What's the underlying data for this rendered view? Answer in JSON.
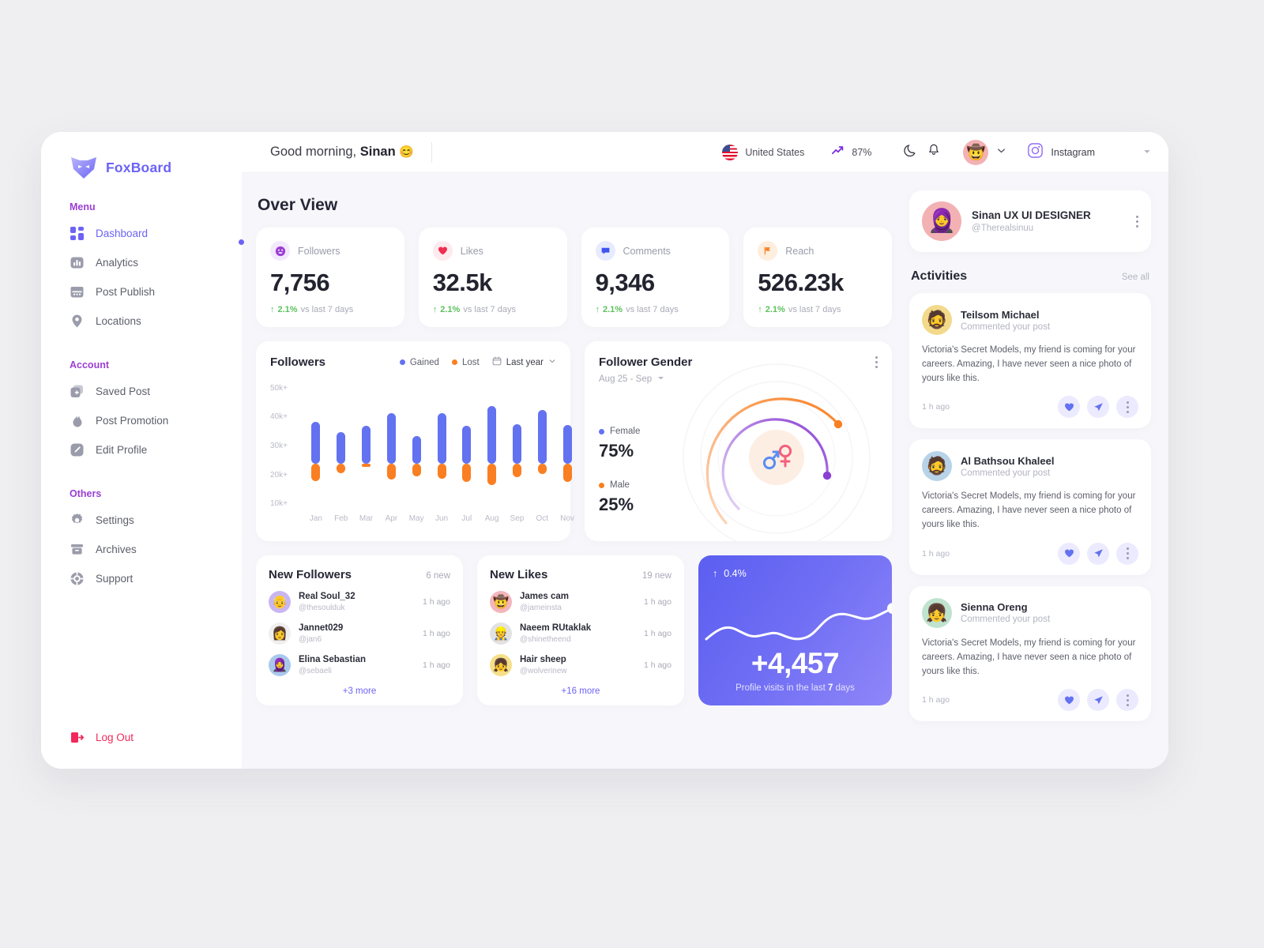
{
  "brand": {
    "name": "FoxBoard",
    "logo_icon": "fox-logo-icon",
    "color": "#6c63f5"
  },
  "sidebar": {
    "sections": [
      {
        "title": "Menu",
        "items": [
          {
            "label": "Dashboard",
            "icon": "grid-icon",
            "active": true
          },
          {
            "label": "Analytics",
            "icon": "bar-chart-icon",
            "active": false
          },
          {
            "label": "Post Publish",
            "icon": "calendar-icon",
            "active": false
          },
          {
            "label": "Locations",
            "icon": "map-pin-icon",
            "active": false
          }
        ]
      },
      {
        "title": "Account",
        "items": [
          {
            "label": "Saved Post",
            "icon": "bookmark-add-icon",
            "active": false
          },
          {
            "label": "Post Promotion",
            "icon": "flame-icon",
            "active": false
          },
          {
            "label": "Edit Profile",
            "icon": "pencil-icon",
            "active": false
          }
        ]
      },
      {
        "title": "Others",
        "items": [
          {
            "label": "Settings",
            "icon": "gear-icon",
            "active": false
          },
          {
            "label": "Archives",
            "icon": "archive-icon",
            "active": false
          },
          {
            "label": "Support",
            "icon": "lifebuoy-icon",
            "active": false
          }
        ]
      }
    ],
    "logout": {
      "label": "Log Out",
      "icon": "logout-icon",
      "color": "#f2285a"
    }
  },
  "topbar": {
    "greeting_prefix": "Good morning, ",
    "greeting_name": "Sinan",
    "greeting_emoji": "😊",
    "country": "United States",
    "country_flag_icon": "us-flag-icon",
    "trend_value": "87%",
    "trend_icon": "trending-up-icon",
    "dark_mode_icon": "moon-icon",
    "notification_icon": "bell-icon",
    "avatar_icon": "user-avatar",
    "avatar_chevron_icon": "chevron-down-icon",
    "platform": "Instagram",
    "platform_icon": "instagram-icon",
    "platform_chevron_icon": "caret-down-icon"
  },
  "overview": {
    "title": "Over View",
    "stats": [
      {
        "label": "Followers",
        "value": "7,756",
        "delta": "2.1%",
        "delta_note": "vs last 7 days",
        "icon": "smiley-icon",
        "icon_bg": "#f3e9fd",
        "icon_color": "#9b3fd4"
      },
      {
        "label": "Likes",
        "value": "32.5k",
        "delta": "2.1%",
        "delta_note": "vs last 7 days",
        "icon": "heart-icon",
        "icon_bg": "#fdeaee",
        "icon_color": "#f02d52"
      },
      {
        "label": "Comments",
        "value": "9,346",
        "delta": "2.1%",
        "delta_note": "vs last 7 days",
        "icon": "comment-icon",
        "icon_bg": "#e8ebfe",
        "icon_color": "#3d54ef"
      },
      {
        "label": "Reach",
        "value": "526.23k",
        "delta": "2.1%",
        "delta_note": "vs last 7 days",
        "icon": "flag-icon",
        "icon_bg": "#fdeede",
        "icon_color": "#fa7f22"
      }
    ]
  },
  "followers_chart": {
    "title": "Followers",
    "legend": [
      {
        "label": "Gained",
        "color": "#6372f0"
      },
      {
        "label": "Lost",
        "color": "#fa7f22"
      }
    ],
    "range_label": "Last year",
    "range_icon": "calendar-icon",
    "range_chevron_icon": "chevron-down-icon"
  },
  "gender_chart": {
    "title": "Follower Gender",
    "date_range": "Aug 25 - Sep",
    "date_chevron_icon": "caret-down-icon",
    "menu_icon": "kebab-menu-icon",
    "center_icon": "gender-symbols-icon",
    "items": [
      {
        "label": "Female",
        "value": "75%",
        "color": "#6372f0",
        "ring_color": "#8b3fd4"
      },
      {
        "label": "Male",
        "value": "25%",
        "color": "#fa7f22",
        "ring_color": "#fa7f22"
      }
    ]
  },
  "chart_data": [
    {
      "type": "bar",
      "title": "Followers",
      "xlabel": "",
      "ylabel": "",
      "categories": [
        "Jan",
        "Feb",
        "Mar",
        "Apr",
        "May",
        "Jun",
        "Jul",
        "Aug",
        "Sep",
        "Oct",
        "Nov"
      ],
      "ytick_labels": [
        "50k+",
        "40k+",
        "30k+",
        "20k+",
        "10k+"
      ],
      "ytick_values": [
        50000,
        40000,
        30000,
        20000,
        10000
      ],
      "ylim": [
        7000,
        53000
      ],
      "grid": false,
      "legend_position": "top-right",
      "series": [
        {
          "name": "Gained",
          "color": "#6372f0",
          "values": [
            38500,
            35000,
            37000,
            41500,
            33500,
            41500,
            37000,
            44000,
            37800,
            42500,
            37500
          ]
        },
        {
          "name": "Lost",
          "color": "#fa7f22",
          "values": [
            18000,
            20800,
            23000,
            18600,
            19500,
            18700,
            17700,
            16700,
            19400,
            20300,
            17700
          ]
        }
      ],
      "series_base": 24000,
      "note": "Each column spans from the Lost value (bottom, orange) up to the Gained value (top, blue), meeting near 24k."
    },
    {
      "type": "pie",
      "title": "Follower Gender",
      "subtitle": "Aug 25 - Sep",
      "labels": [
        "Female",
        "Male"
      ],
      "values": [
        75,
        25
      ],
      "colors": [
        "#8b3fd4",
        "#fa7f22"
      ],
      "legend_position": "left"
    },
    {
      "type": "line",
      "title": "Profile visits in the last 7 days",
      "value_label": "+4,457",
      "delta": "0.4%",
      "x": [
        0,
        1,
        2,
        3,
        4,
        5,
        6,
        7,
        8,
        9,
        10
      ],
      "y": [
        18,
        26,
        20,
        25,
        19,
        18,
        30,
        36,
        33,
        36,
        40
      ],
      "color": "#ffffff",
      "grid": false
    }
  ],
  "new_followers": {
    "title": "New Followers",
    "count": "6 new",
    "items": [
      {
        "name": "Real Soul_32",
        "handle": "@thesoulduk",
        "time": "1 h ago",
        "avatar_bg": "#c9b6f0",
        "emoji": "👴"
      },
      {
        "name": "Jannet029",
        "handle": "@jan6",
        "time": "1 h ago",
        "avatar_bg": "#efefef",
        "emoji": "👩"
      },
      {
        "name": "Elina Sebastian",
        "handle": "@sebaeli",
        "time": "1 h ago",
        "avatar_bg": "#a9c9ec",
        "emoji": "🧕"
      }
    ],
    "more_label": "+3 more"
  },
  "new_likes": {
    "title": "New Likes",
    "count": "19 new",
    "items": [
      {
        "name": "James cam",
        "handle": "@jameinsta",
        "time": "1 h ago",
        "avatar_bg": "#f3b6bc",
        "emoji": "🤠"
      },
      {
        "name": "Naeem RUtaklak",
        "handle": "@shinetheend",
        "time": "1 h ago",
        "avatar_bg": "#e2e2e2",
        "emoji": "👷"
      },
      {
        "name": "Hair sheep",
        "handle": "@wolverinew",
        "time": "1 h ago",
        "avatar_bg": "#f5e08a",
        "emoji": "👧"
      }
    ],
    "more_label": "+16 more"
  },
  "profile_visits": {
    "delta": "0.4%",
    "delta_icon": "arrow-up-icon",
    "value": "+4,457",
    "caption_before": "Profile visits in the last ",
    "caption_bold": "7",
    "caption_after": " days"
  },
  "profile": {
    "name": "Sinan UX UI DESIGNER",
    "handle": "@Therealsinuu",
    "avatar_bg": "#f3b1b4",
    "avatar_emoji": "🧕",
    "menu_icon": "kebab-menu-icon"
  },
  "activities": {
    "title": "Activities",
    "see_all": "See all",
    "items": [
      {
        "name": "Teilsom Michael",
        "action": "Commented your post",
        "body": "Victoria's Secret Models, my friend is coming for your careers. Amazing, I have never seen a nice photo of yours like this.",
        "time": "1 h ago",
        "avatar_bg": "#f3d98a",
        "avatar_emoji": "🧔",
        "actions": [
          {
            "icon": "heart-icon"
          },
          {
            "icon": "send-icon"
          },
          {
            "icon": "kebab-menu-icon"
          }
        ]
      },
      {
        "name": "Al Bathsou Khaleel",
        "action": "Commented your post",
        "body": "Victoria's Secret Models, my friend is coming for your careers. Amazing, I have never seen a nice photo of yours like this.",
        "time": "1 h ago",
        "avatar_bg": "#b8d3e8",
        "avatar_emoji": "🧔",
        "actions": [
          {
            "icon": "heart-icon"
          },
          {
            "icon": "send-icon"
          },
          {
            "icon": "kebab-menu-icon"
          }
        ]
      },
      {
        "name": "Sienna Oreng",
        "action": "Commented your post",
        "body": "Victoria's Secret Models, my friend is coming for your careers. Amazing, I have never seen a nice photo of yours like this.",
        "time": "1 h ago",
        "avatar_bg": "#bfe3cf",
        "avatar_emoji": "👧",
        "actions": [
          {
            "icon": "heart-icon"
          },
          {
            "icon": "send-icon"
          },
          {
            "icon": "kebab-menu-icon"
          }
        ]
      }
    ]
  }
}
